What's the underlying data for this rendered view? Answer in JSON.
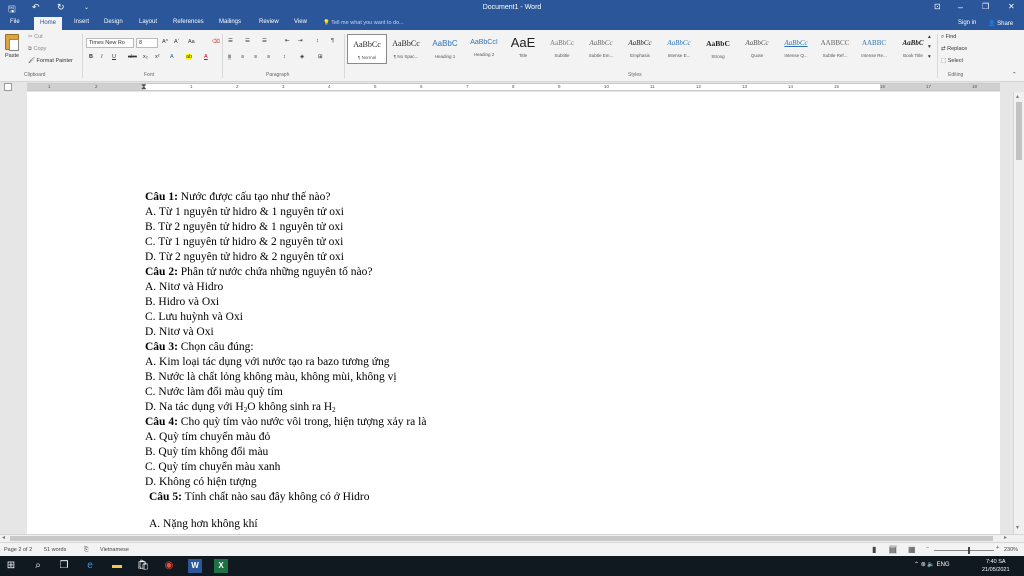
{
  "window": {
    "title": "Document1 - Word",
    "quick_access": [
      "save-icon",
      "undo-icon",
      "redo-icon",
      "customize-icon"
    ],
    "controls": {
      "restore_ribbon": "⊡",
      "minimize": "–",
      "maximize": "❐",
      "close": "✕"
    }
  },
  "tabs": [
    "File",
    "Home",
    "Insert",
    "Design",
    "Layout",
    "References",
    "Mailings",
    "Review",
    "View"
  ],
  "tell_me": "Tell me what you want to do...",
  "account": {
    "signin": "Sign in",
    "share": "Share"
  },
  "ribbon": {
    "clipboard": {
      "paste": "Paste",
      "cut": "Cut",
      "copy": "Copy",
      "format_painter": "Format Painter",
      "label": "Clipboard"
    },
    "font": {
      "name": "Times New Ro",
      "size": "8",
      "bold": "B",
      "italic": "I",
      "underline": "U",
      "strike": "abc",
      "subscript": "x₂",
      "superscript": "x²",
      "grow": "A^",
      "shrink": "Aˇ",
      "case": "Aa",
      "label": "Font"
    },
    "paragraph": {
      "label": "Paragraph"
    },
    "styles": {
      "label": "Styles",
      "items": [
        {
          "sample": "AaBbCc",
          "name": "¶ Normal"
        },
        {
          "sample": "AaBbCc",
          "name": "¶ No Spac..."
        },
        {
          "sample": "AaBbC",
          "name": "Heading 1"
        },
        {
          "sample": "AaBbCcI",
          "name": "Heading 2"
        },
        {
          "sample": "AaE",
          "name": "Title"
        },
        {
          "sample": "AaBbCc",
          "name": "Subtitle"
        },
        {
          "sample": "AaBbCc",
          "name": "Subtle Em..."
        },
        {
          "sample": "AaBbCc",
          "name": "Emphasis"
        },
        {
          "sample": "AaBbCc",
          "name": "Intense E..."
        },
        {
          "sample": "AaBbC",
          "name": "Strong"
        },
        {
          "sample": "AaBbCc",
          "name": "Quote"
        },
        {
          "sample": "AaBbCc",
          "name": "Intense Q..."
        },
        {
          "sample": "AABBCC",
          "name": "Subtle Ref..."
        },
        {
          "sample": "AABBC",
          "name": "Intense Re..."
        },
        {
          "sample": "AaBbC",
          "name": "Book Title"
        }
      ]
    },
    "editing": {
      "find": "Find",
      "replace": "Replace",
      "select": "Select",
      "label": "Editing"
    }
  },
  "ruler_ticks": [
    "1",
    "2",
    "1",
    "2",
    "3",
    "4",
    "5",
    "6",
    "7",
    "8",
    "9",
    "10",
    "11",
    "12",
    "13",
    "14",
    "15",
    "16",
    "17",
    "18"
  ],
  "document": {
    "lines": [
      {
        "bold": "Câu 1:",
        "text": " Nước được cấu tạo như thế nào?"
      },
      {
        "bold": "",
        "text": "A. Từ 1 nguyên tử hidro & 1 nguyên tử oxi"
      },
      {
        "bold": "",
        "text": "B. Từ 2 nguyên tử hidro & 1 nguyên tử oxi"
      },
      {
        "bold": "",
        "text": "C. Từ 1 nguyên tử hidro & 2 nguyên tử oxi"
      },
      {
        "bold": "",
        "text": "D. Từ 2 nguyên tử hidro & 2 nguyên tử oxi"
      },
      {
        "bold": "Câu 2:",
        "text": " Phân tử nước chứa những nguyên tố nào?"
      },
      {
        "bold": "",
        "text": "A. Nitơ và Hidro"
      },
      {
        "bold": "",
        "text": "B. Hidro và Oxi"
      },
      {
        "bold": "",
        "text": "C. Lưu huỳnh và Oxi"
      },
      {
        "bold": "",
        "text": "D. Nitơ và Oxi"
      },
      {
        "bold": "Câu 3:",
        "text": " Chọn câu đúng:"
      },
      {
        "bold": "",
        "text": "A. Kim loại tác dụng với nước tạo ra bazo tương ứng"
      },
      {
        "bold": "",
        "text": "B. Nước là chất lỏng không màu, không mùi, không vị"
      },
      {
        "bold": "",
        "text": "C. Nước làm đổi màu quỳ tím"
      }
    ],
    "q3d": {
      "pre": "D. Na tác dụng với H",
      "sub1": "2",
      "mid": "O không sinh ra H",
      "sub2": "2"
    },
    "lines2": [
      {
        "bold": "Câu 4:",
        "text": " Cho quỳ tím vào nước vôi trong, hiện tượng xảy ra là"
      },
      {
        "bold": "",
        "text": "A. Quỳ tím chuyển màu đỏ"
      },
      {
        "bold": "",
        "text": "B. Quỳ tím không đổi màu"
      },
      {
        "bold": "",
        "text": "C. Quỳ tím chuyển màu xanh"
      },
      {
        "bold": "",
        "text": "D. Không có hiện tượng"
      }
    ],
    "q5": {
      "bold": "Câu 5:",
      "text": " Tính chất nào sau đây không có ở Hidro"
    },
    "cut_line": "A. Nặng hơn không khí"
  },
  "status": {
    "page": "Page 2 of 2",
    "words": "51 words",
    "language": "Vietnamese",
    "zoom": "230%"
  },
  "taskbar": {
    "time": "7:40 SA",
    "date": "21/05/2021",
    "lang": "ENG"
  }
}
